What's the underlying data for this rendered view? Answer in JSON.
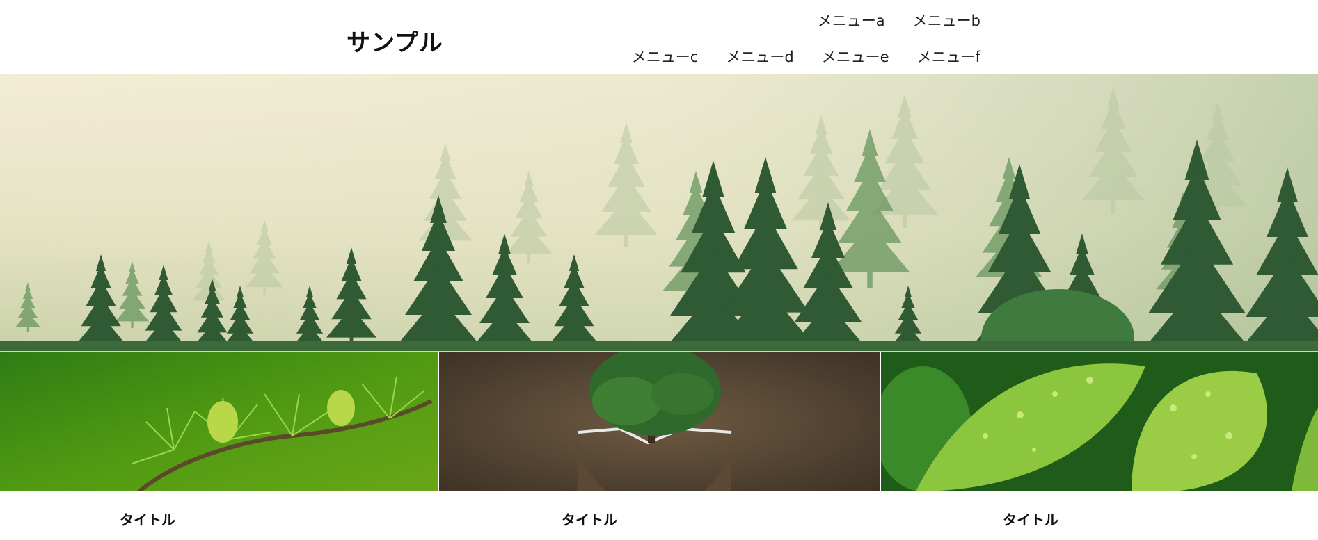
{
  "header": {
    "site_title": "サンプル",
    "nav": {
      "row1": [
        "メニューa",
        "メニューb"
      ],
      "row2": [
        "メニューc",
        "メニューd",
        "メニューe",
        "メニューf"
      ]
    }
  },
  "hero": {
    "image": "misty-pine-forest-image"
  },
  "cards": [
    {
      "image": "larch-branch-image",
      "title": "タイトル"
    },
    {
      "image": "tree-in-glass-sphere-image",
      "title": "タイトル"
    },
    {
      "image": "wet-green-leaves-image",
      "title": "タイトル"
    }
  ],
  "colors": {
    "background": "#ffffff",
    "text": "#111111",
    "forest_dark": "#2f5a34",
    "fog": "#efe9cf",
    "leaf_green": "#8cc63f"
  }
}
